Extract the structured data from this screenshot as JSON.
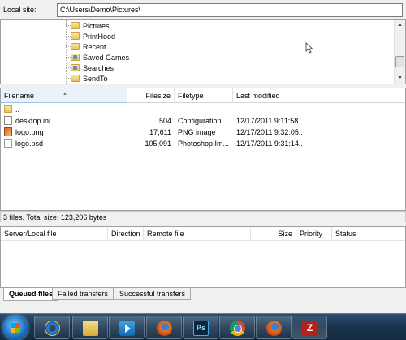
{
  "local_site": {
    "label": "Local site:",
    "path": "C:\\Users\\Demo\\Pictures\\"
  },
  "tree": {
    "items": [
      {
        "label": "Pictures",
        "icon": "folder-icon"
      },
      {
        "label": "PrintHood",
        "icon": "folder-icon"
      },
      {
        "label": "Recent",
        "icon": "folder-icon"
      },
      {
        "label": "Saved Games",
        "icon": "saved-games-folder-icon"
      },
      {
        "label": "Searches",
        "icon": "searches-folder-icon"
      },
      {
        "label": "SendTo",
        "icon": "folder-icon"
      }
    ]
  },
  "file_list": {
    "columns": {
      "filename": "Filename",
      "filesize": "Filesize",
      "filetype": "Filetype",
      "modified": "Last modified"
    },
    "rows": [
      {
        "name": "..",
        "size": "",
        "type": "",
        "modified": "",
        "icon": "parent-folder-icon"
      },
      {
        "name": "desktop.ini",
        "size": "504",
        "type": "Configuration ...",
        "modified": "12/17/2011 9:11:58...",
        "icon": "settings-file-icon"
      },
      {
        "name": "logo.png",
        "size": "17,611",
        "type": "PNG image",
        "modified": "12/17/2011 9:32:05...",
        "icon": "image-file-icon"
      },
      {
        "name": "logo.psd",
        "size": "105,091",
        "type": "Photoshop.Im...",
        "modified": "12/17/2011 9:31:14...",
        "icon": "blank-file-icon"
      }
    ],
    "status": "3 files. Total size: 123,206 bytes"
  },
  "queue": {
    "columns": {
      "server": "Server/Local file",
      "direction": "Direction",
      "remote": "Remote file",
      "size": "Size",
      "priority": "Priority",
      "status": "Status"
    }
  },
  "tabs": [
    {
      "label": "Queued files",
      "active": true
    },
    {
      "label": "Failed transfers",
      "active": false
    },
    {
      "label": "Successful transfers",
      "active": false
    }
  ],
  "taskbar": {
    "apps": [
      "internet-explorer-icon",
      "windows-explorer-icon",
      "media-player-icon",
      "firefox-icon",
      "photoshop-icon",
      "chrome-icon",
      "firefox-icon",
      "filezilla-icon"
    ],
    "ps_text": "Ps",
    "fz_text": "Z"
  }
}
